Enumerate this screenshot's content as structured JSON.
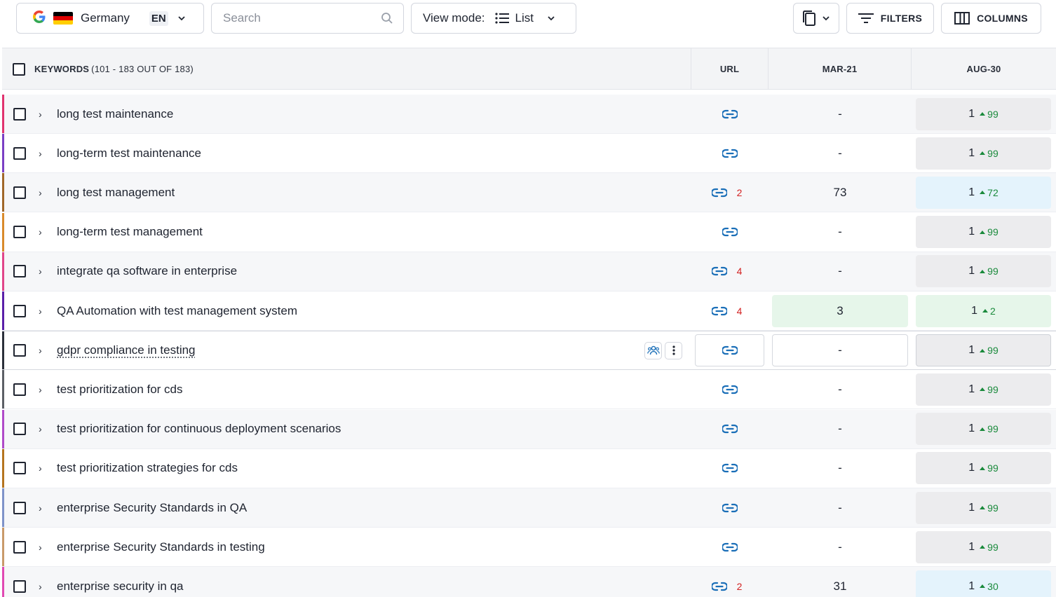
{
  "toolbar": {
    "location": {
      "engine_icon": "google-g-icon",
      "flag": "germany-flag",
      "country": "Germany",
      "language": "EN"
    },
    "search": {
      "placeholder": "Search",
      "value": ""
    },
    "view_mode": {
      "label": "View mode:",
      "value": "List"
    },
    "filters_label": "FILTERS",
    "columns_label": "COLUMNS"
  },
  "header": {
    "keywords_label": "KEYWORDS",
    "keywords_count": "(101 - 183 OUT OF 183)",
    "url_label": "URL",
    "col1_label": "MAR-21",
    "col2_label": "AUG-30"
  },
  "colors": {
    "up_green": "#1a8a3c",
    "url_count_red": "#d32222",
    "link_blue": "#1b6fb8"
  },
  "rows": [
    {
      "keyword": "long test maintenance",
      "stripe": "#e0336f",
      "url_count": "",
      "mar": "-",
      "aug_pos": "1",
      "aug_change": "99",
      "aug_style": "gray",
      "mar_style": ""
    },
    {
      "keyword": "long-term test maintenance",
      "stripe": "#7b3fc4",
      "url_count": "",
      "mar": "-",
      "aug_pos": "1",
      "aug_change": "99",
      "aug_style": "gray",
      "mar_style": ""
    },
    {
      "keyword": "long test management",
      "stripe": "#a0672a",
      "url_count": "2",
      "mar": "73",
      "aug_pos": "1",
      "aug_change": "72",
      "aug_style": "blue",
      "mar_style": ""
    },
    {
      "keyword": "long-term test management",
      "stripe": "#d98a2b",
      "url_count": "",
      "mar": "-",
      "aug_pos": "1",
      "aug_change": "99",
      "aug_style": "gray",
      "mar_style": ""
    },
    {
      "keyword": "integrate qa software in enterprise",
      "stripe": "#e0468a",
      "url_count": "4",
      "mar": "-",
      "aug_pos": "1",
      "aug_change": "99",
      "aug_style": "gray",
      "mar_style": ""
    },
    {
      "keyword": "QA Automation with test management system",
      "stripe": "#5a1fa8",
      "url_count": "4",
      "mar": "3",
      "aug_pos": "1",
      "aug_change": "2",
      "aug_style": "green",
      "mar_style": "green"
    },
    {
      "keyword": "gdpr compliance in testing",
      "stripe": "#2b2f3a",
      "url_count": "",
      "mar": "-",
      "aug_pos": "1",
      "aug_change": "99",
      "aug_style": "boxed",
      "mar_style": "boxed",
      "hovered": true
    },
    {
      "keyword": "test prioritization for cds",
      "stripe": "#5c5f66",
      "url_count": "",
      "mar": "-",
      "aug_pos": "1",
      "aug_change": "99",
      "aug_style": "gray",
      "mar_style": ""
    },
    {
      "keyword": "test prioritization for continuous deployment scenarios",
      "stripe": "#b04bc9",
      "url_count": "",
      "mar": "-",
      "aug_pos": "1",
      "aug_change": "99",
      "aug_style": "gray",
      "mar_style": ""
    },
    {
      "keyword": "test prioritization strategies for cds",
      "stripe": "#b5741f",
      "url_count": "",
      "mar": "-",
      "aug_pos": "1",
      "aug_change": "99",
      "aug_style": "gray",
      "mar_style": ""
    },
    {
      "keyword": "enterprise Security Standards in QA",
      "stripe": "#7f93c9",
      "url_count": "",
      "mar": "-",
      "aug_pos": "1",
      "aug_change": "99",
      "aug_style": "gray",
      "mar_style": ""
    },
    {
      "keyword": "enterprise Security Standards in testing",
      "stripe": "#c99a6a",
      "url_count": "",
      "mar": "-",
      "aug_pos": "1",
      "aug_change": "99",
      "aug_style": "gray",
      "mar_style": ""
    },
    {
      "keyword": "enterprise security in qa",
      "stripe": "#e04ab3",
      "url_count": "2",
      "mar": "31",
      "aug_pos": "1",
      "aug_change": "30",
      "aug_style": "blue",
      "mar_style": ""
    }
  ]
}
